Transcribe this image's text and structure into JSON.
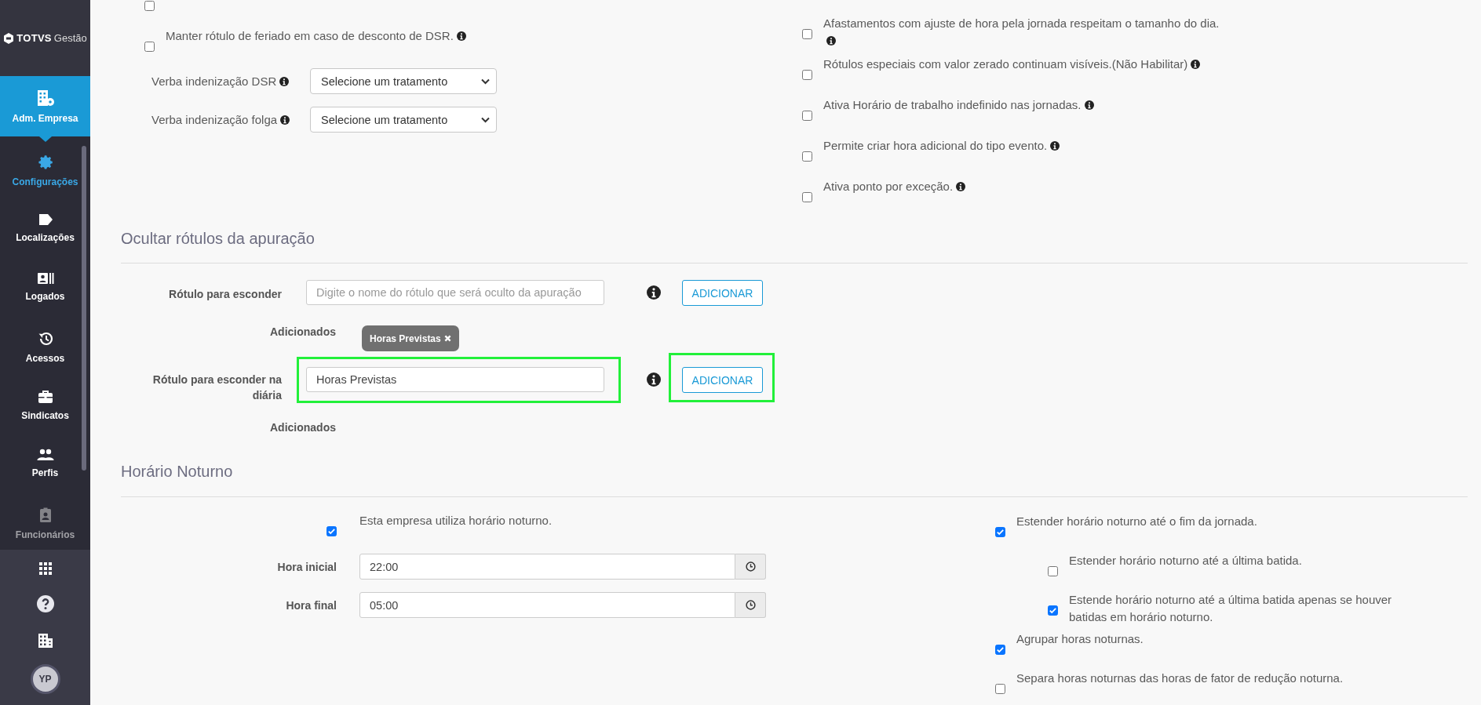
{
  "sidebar": {
    "logo": "TOTVS",
    "product": "Gestão",
    "module": {
      "label": "Adm. Empresa"
    },
    "items": [
      {
        "label": "Configurações",
        "selected": true
      },
      {
        "label": "Localizações",
        "selected": false
      },
      {
        "label": "Logados",
        "selected": false
      },
      {
        "label": "Acessos",
        "selected": false
      },
      {
        "label": "Sindicatos",
        "selected": false
      },
      {
        "label": "Perfis",
        "selected": false
      },
      {
        "label": "Funcionários",
        "selected": false
      }
    ],
    "user": {
      "initials": "YP"
    }
  },
  "settings_left": [
    {
      "checked": false
    },
    {
      "label": "Manter rótulo de feriado em caso de desconto de DSR.",
      "checked": false,
      "info": true
    }
  ],
  "treatments": [
    {
      "label": "Verba indenização DSR",
      "value": "Selecione um tratamento",
      "info": true
    },
    {
      "label": "Verba indenização folga",
      "value": "Selecione um tratamento",
      "info": true
    }
  ],
  "settings_right": [
    {
      "label": "Afastamentos com ajuste de hora pela jornada respeitam o tamanho do dia.",
      "checked": false,
      "info": true
    },
    {
      "label": "Rótulos especiais com valor zerado continuam visíveis.(Não Habilitar)",
      "checked": false,
      "info": true
    },
    {
      "label": "Ativa Horário de trabalho indefinido nas jornadas.",
      "checked": false,
      "info": true
    },
    {
      "label": "Permite criar hora adicional do tipo evento.",
      "checked": false,
      "info": true
    },
    {
      "label": "Ativa ponto por exceção.",
      "checked": false,
      "info": true
    }
  ],
  "hidden_labels": {
    "title": "Ocultar rótulos da apuração",
    "rows": [
      {
        "label": "Rótulo para esconder",
        "placeholder": "Digite o nome do rótulo que será oculto da apuração",
        "button": "ADICIONAR",
        "highlighted": false,
        "added_label": "Adicionados",
        "tags": [
          {
            "label": "Horas Previstas"
          }
        ]
      },
      {
        "label": "Rótulo para esconder na diária",
        "value": "Horas Previstas",
        "button": "ADICIONAR",
        "highlighted": true,
        "added_label": "Adicionados"
      }
    ]
  },
  "night": {
    "title": "Horário Noturno",
    "enabled": {
      "label": "Esta empresa utiliza horário noturno.",
      "checked": true
    },
    "times": [
      {
        "label": "Hora inicial",
        "value": "22:00"
      },
      {
        "label": "Hora final",
        "value": "05:00"
      }
    ],
    "options": [
      {
        "label": "Estender horário noturno até o fim da jornada.",
        "checked": true,
        "children": [
          {
            "label": "Estender horário noturno até a última batida.",
            "checked": false
          },
          {
            "label": "Estende horário noturno até a última batida apenas se houver batidas em horário noturno.",
            "checked": true
          }
        ]
      },
      {
        "label": "Agrupar horas noturnas.",
        "checked": true
      },
      {
        "label": "Separa horas noturnas das horas de fator de redução noturna.",
        "checked": false
      }
    ]
  }
}
